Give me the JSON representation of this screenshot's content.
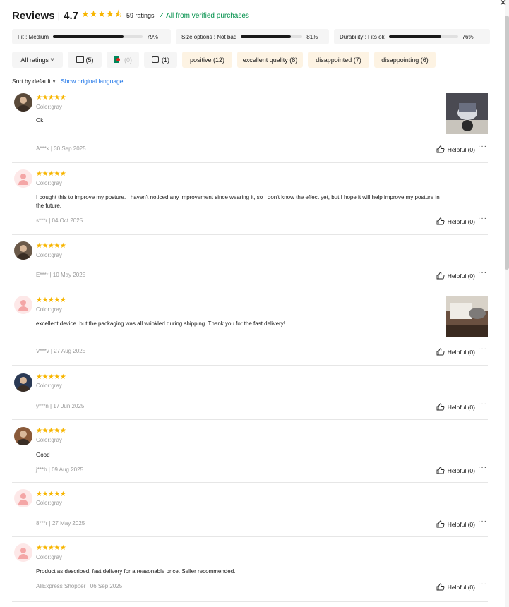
{
  "header": {
    "title": "Reviews",
    "separator": "|",
    "score": "4.7",
    "stars": "★★★★⯪",
    "ratings_count": "59 ratings",
    "verified": "✓ All from verified purchases"
  },
  "fit": [
    {
      "label": "Fit : Medium",
      "percent": 79,
      "percent_label": "79%"
    },
    {
      "label": "Size options : Not bad",
      "percent": 81,
      "percent_label": "81%"
    },
    {
      "label": "Durability : Fits ok",
      "percent": 76,
      "percent_label": "76%"
    }
  ],
  "filters": {
    "all_ratings": "All ratings ˅",
    "images": "(5)",
    "local": "(0)",
    "comments": "(1)",
    "keywords": [
      "positive (12)",
      "excellent quality (8)",
      "disappointed (7)",
      "disappointing (6)"
    ]
  },
  "sort": {
    "label": "Sort by default ˅",
    "original_language": "Show original language"
  },
  "review_common": {
    "stars": "★★★★★",
    "sku": "Color:gray",
    "helpful": "Helpful (0)",
    "more": "···"
  },
  "reviews": [
    {
      "text": "Ok",
      "meta": "A***k | 30 Sep 2025",
      "avatar": "photo",
      "has_photo": true
    },
    {
      "text": "I bought this to improve my posture. I haven't noticed any improvement since wearing it, so I don't know the effect yet, but I hope it will help improve my posture in the future.",
      "meta": "s***r | 04 Oct 2025",
      "avatar": "default",
      "has_photo": false
    },
    {
      "text": "",
      "meta": "E***r | 10 May 2025",
      "avatar": "photo",
      "has_photo": false
    },
    {
      "text": "excellent device. but the packaging was all wrinkled during shipping. Thank you for the fast delivery!",
      "meta": "V***v | 27 Aug 2025",
      "avatar": "default",
      "has_photo": true
    },
    {
      "text": "",
      "meta": "y***n | 17 Jun 2025",
      "avatar": "photo",
      "has_photo": false
    },
    {
      "text": "Good",
      "meta": "j***b | 09 Aug 2025",
      "avatar": "photo",
      "has_photo": false
    },
    {
      "text": "",
      "meta": "8***r | 27 May 2025",
      "avatar": "default",
      "has_photo": false
    },
    {
      "text": "Product as described, fast delivery for a reasonable price. Seller recommended.",
      "meta": "AliExpress Shopper | 06 Sep 2025",
      "avatar": "default",
      "has_photo": false
    }
  ]
}
